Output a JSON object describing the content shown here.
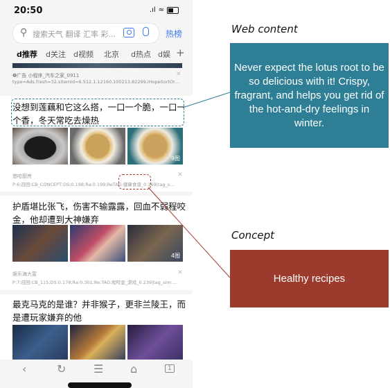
{
  "status": {
    "time": "20:50",
    "signal": ".ıl",
    "wifi": "≈"
  },
  "search": {
    "placeholder": "搜索天气 翻译 汇率 彩...",
    "hot_label": "热榜"
  },
  "tabs": [
    "d推荐",
    "d关注",
    "d视频",
    "北京",
    "d热点",
    "d娱"
  ],
  "ad": {
    "label": "❷广告  小程序_汽车之家_0911",
    "meta": "type=Ads,fresh=32,sitemId=6,512,1,12160,100213,82299,iHopeSortOr..."
  },
  "article1": {
    "title": "没想到莲藕和它这么搭，一口一个脆，一口一个香，冬天常吃去燥热",
    "image_count": "9图",
    "source": "悠哈厨房",
    "meta": "P:6;召回:CB_CONCEPT;DS:0.198;Ra:0.199;ReTAG:健康食谱_0.169|tag_s..."
  },
  "article2": {
    "title": "护盾堪比张飞，伤害不输露露，回血不弱程咬金，他却遭到大神嫌弃",
    "image_count": "4图",
    "source": "娱乐海大富",
    "meta": "P:7;召回:CB_115;DS:0.178;Ra:0.301;Re:TAG:程咬金_游戏_0.239|tag_sim:..."
  },
  "article3": {
    "title": "最克马克的是谁？并非猴子，更非兰陵王，而是遭玩家嫌弃的他"
  },
  "nav": {
    "back": "‹",
    "refresh": "↻",
    "menu": "☰",
    "home": "⌂",
    "tabs_count": "1"
  },
  "annotations": {
    "web_content_label": "Web content",
    "web_content_text": "Never expect the lotus root to be so delicious with it! Crispy, fragrant, and helps you get rid of the hot-and-dry feelings in winter.",
    "concept_label": "Concept",
    "concept_text": "Healthy recipes"
  },
  "colors": {
    "accent": "#3c7bf0",
    "web_content_box": "#2e7f96",
    "concept_box": "#9d3a2e"
  }
}
